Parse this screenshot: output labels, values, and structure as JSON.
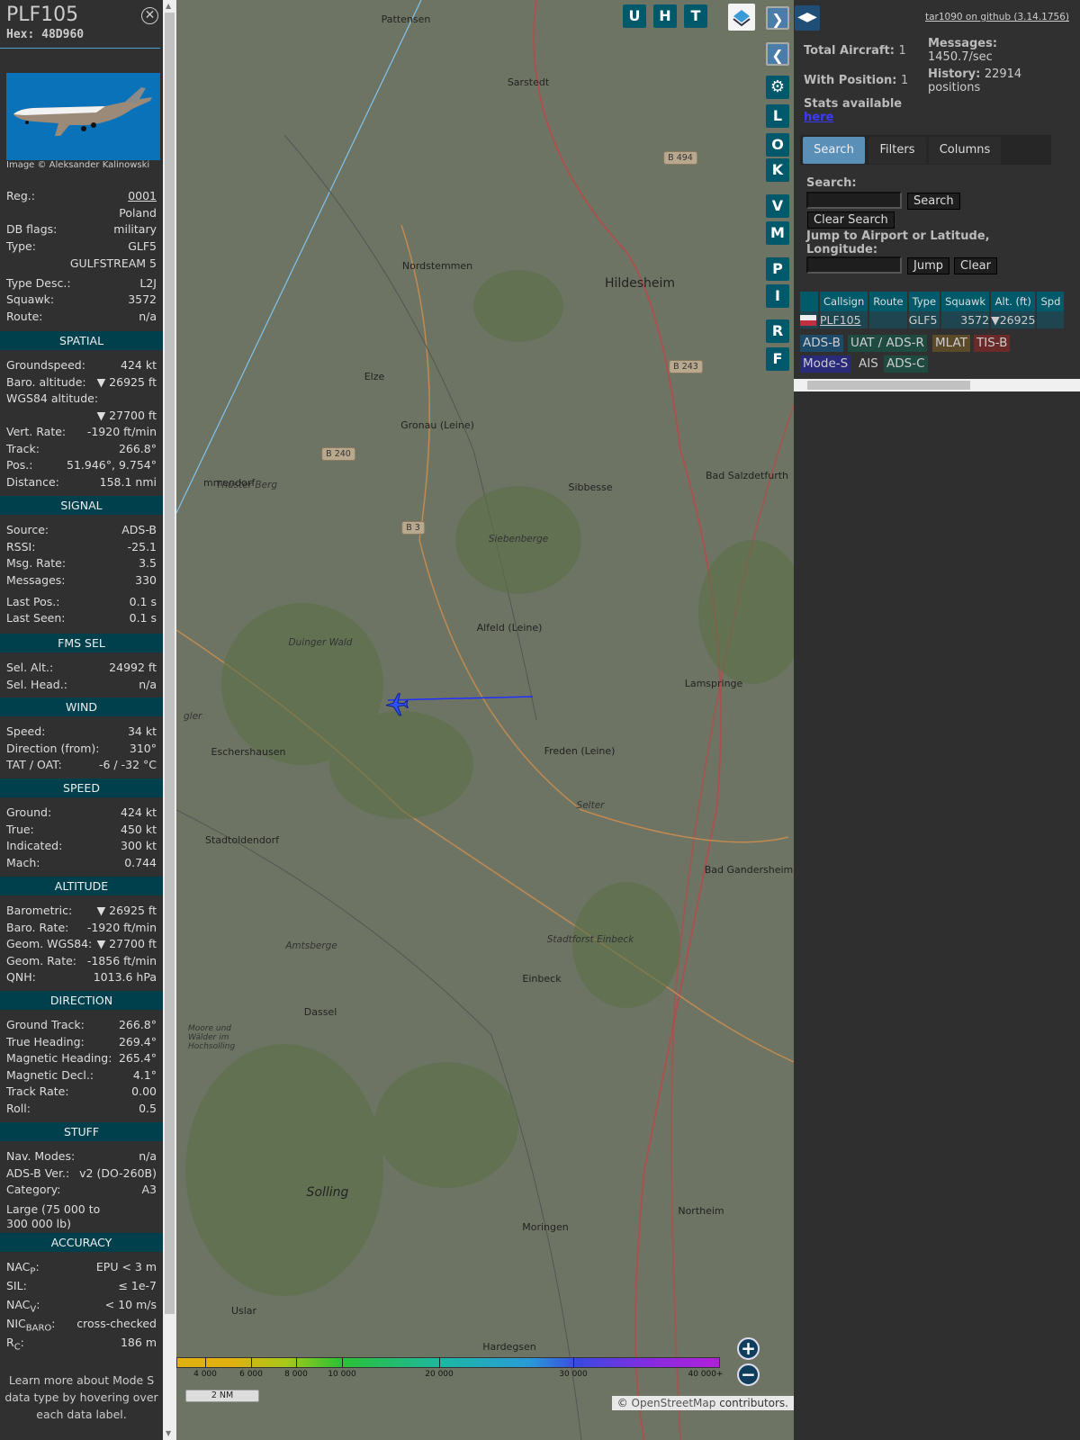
{
  "aircraft": {
    "callsign": "PLF105",
    "hex": "Hex: 48D960",
    "photo_credit": "Image © Aleksander Kalinowski"
  },
  "info": [
    {
      "k": "Reg.:",
      "v": "0001"
    },
    {
      "k": "",
      "v": "Poland"
    },
    {
      "k": "DB flags:",
      "v": "military"
    },
    {
      "k": "Type:",
      "v": "GLF5"
    },
    {
      "k": "",
      "v": "GULFSTREAM 5"
    },
    {
      "k": "Type Desc.:",
      "v": "L2J"
    },
    {
      "k": "Squawk:",
      "v": "3572"
    },
    {
      "k": "Route:",
      "v": "n/a"
    }
  ],
  "sections": [
    {
      "title": "SPATIAL",
      "rows": [
        {
          "k": "Groundspeed:",
          "v": "424 kt"
        },
        {
          "k": "Baro. altitude:",
          "v": "▼ 26925 ft"
        },
        {
          "k": "WGS84 altitude:",
          "v": ""
        },
        {
          "k": "",
          "v": "▼ 27700 ft"
        },
        {
          "k": "Vert. Rate:",
          "v": "-1920 ft/min"
        },
        {
          "k": "Track:",
          "v": "266.8°"
        },
        {
          "k": "Pos.:",
          "v": "51.946°, 9.754°"
        },
        {
          "k": "Distance:",
          "v": "158.1 nmi"
        }
      ]
    },
    {
      "title": "SIGNAL",
      "rows": [
        {
          "k": "Source:",
          "v": "ADS-B"
        },
        {
          "k": "RSSI:",
          "v": "-25.1"
        },
        {
          "k": "Msg. Rate:",
          "v": "3.5"
        },
        {
          "k": "Messages:",
          "v": "330"
        },
        {
          "k": "Last Pos.:",
          "v": "0.1 s"
        },
        {
          "k": "Last Seen:",
          "v": "0.1 s"
        }
      ]
    },
    {
      "title": "FMS SEL",
      "rows": [
        {
          "k": "Sel. Alt.:",
          "v": "24992 ft"
        },
        {
          "k": "Sel. Head.:",
          "v": "n/a"
        }
      ]
    },
    {
      "title": "WIND",
      "rows": [
        {
          "k": "Speed:",
          "v": "34 kt"
        },
        {
          "k": "Direction (from):",
          "v": "310°"
        },
        {
          "k": "TAT / OAT:",
          "v": "-6 / -32 °C"
        }
      ]
    },
    {
      "title": "SPEED",
      "rows": [
        {
          "k": "Ground:",
          "v": "424 kt"
        },
        {
          "k": "True:",
          "v": "450 kt"
        },
        {
          "k": "Indicated:",
          "v": "300 kt"
        },
        {
          "k": "Mach:",
          "v": "0.744"
        }
      ]
    },
    {
      "title": "ALTITUDE",
      "rows": [
        {
          "k": "Barometric:",
          "v": "▼ 26925 ft"
        },
        {
          "k": "Baro. Rate:",
          "v": "-1920 ft/min"
        },
        {
          "k": "Geom. WGS84:",
          "v": "▼ 27700 ft"
        },
        {
          "k": "Geom. Rate:",
          "v": "-1856 ft/min"
        },
        {
          "k": "QNH:",
          "v": "1013.6 hPa"
        }
      ]
    },
    {
      "title": "DIRECTION",
      "rows": [
        {
          "k": "Ground Track:",
          "v": "266.8°"
        },
        {
          "k": "True Heading:",
          "v": "269.4°"
        },
        {
          "k": "Magnetic Heading:",
          "v": "265.4°"
        },
        {
          "k": "Magnetic Decl.:",
          "v": "4.1°"
        },
        {
          "k": "Track Rate:",
          "v": "0.00"
        },
        {
          "k": "Roll:",
          "v": "0.5"
        }
      ]
    },
    {
      "title": "STUFF",
      "rows": [
        {
          "k": "Nav. Modes:",
          "v": "n/a"
        },
        {
          "k": "ADS-B Ver.:",
          "v": "v2 (DO-260B)"
        },
        {
          "k": "Category:",
          "v": "A3"
        }
      ],
      "category_desc_1": "Large (75 000 to",
      "category_desc_2": "300 000 lb)"
    },
    {
      "title": "ACCURACY",
      "rows": [
        {
          "k": "NAC",
          "sub": "P",
          "v": "EPU < 3 m"
        },
        {
          "k": "SIL:",
          "v": "≤ 1e-7"
        },
        {
          "k": "NAC",
          "sub": "V",
          "v": "< 10 m/s"
        },
        {
          "k": "NIC",
          "sub": "BARO",
          "v": "cross-checked"
        },
        {
          "k": "R",
          "sub": "C",
          "v": "186 m"
        }
      ]
    }
  ],
  "learn_more": "Learn more about Mode S data type by hovering over each data label.",
  "map": {
    "top_buttons": [
      "U",
      "H",
      "T"
    ],
    "side_buttons": [
      "L",
      "O",
      "K",
      "V",
      "M",
      "P",
      "I",
      "R",
      "F"
    ],
    "labels": [
      "Pattensen",
      "Sarstedt",
      "Nordstemmen",
      "Hildesheim",
      "Elze",
      "Gronau (Leine)",
      "Sibbesse",
      "Bad Salzdetfurth",
      "Siebenberge",
      "Alfeld (Leine)",
      "Lamspringe",
      "Eschershausen",
      "Freden (Leine)",
      "Stadtoldendorf",
      "Bad Gandersheim",
      "Einbeck",
      "Dassel",
      "Solling",
      "Moringen",
      "Northeim",
      "Uslar",
      "Hardegsen",
      "Thüster Berg",
      "Duinger Wald",
      "Amtsberge",
      "Stadtforst Einbeck",
      "Selter",
      "Moore und Wälder im Hochsolling",
      "mmendorf",
      "gler"
    ],
    "roads": [
      "B 494",
      "B 243",
      "B 240",
      "B 3"
    ],
    "legend_ticks": [
      "4 000",
      "6 000",
      "8 000",
      "10 000",
      "20 000",
      "30 000",
      "40 000+"
    ],
    "scale": "2 NM",
    "attribution_prefix": "©",
    "attribution_link": "OpenStreetMap",
    "attribution_suffix": "contributors."
  },
  "right": {
    "github": "tar1090 on github (3.14.1756)",
    "total_label": "Total Aircraft:",
    "total": "1",
    "withpos_label": "With Position:",
    "withpos": "1",
    "messages_label": "Messages:",
    "messages": "1450.7/sec",
    "history_label": "History:",
    "history": "22914",
    "history_unit": "positions",
    "stats": "Stats available",
    "stats_link": "here",
    "tabs": [
      "Search",
      "Filters",
      "Columns"
    ],
    "search_label": "Search:",
    "search_btn": "Search",
    "clear_search": "Clear Search",
    "jump_label": "Jump to Airport or Latitude, Longitude:",
    "jump_btn": "Jump",
    "clear_btn": "Clear",
    "columns": [
      "Callsign",
      "Route",
      "Type",
      "Squawk",
      "Alt. (ft)",
      "Spd"
    ],
    "rows": [
      {
        "callsign": "PLF105",
        "route": "",
        "type": "GLF5",
        "squawk": "3572",
        "alt": "▼26925",
        "spd": ""
      }
    ],
    "sources": [
      "ADS-B",
      "UAT / ADS-R",
      "MLAT",
      "TIS-B",
      "Mode-S",
      "AIS",
      "ADS-C"
    ]
  }
}
